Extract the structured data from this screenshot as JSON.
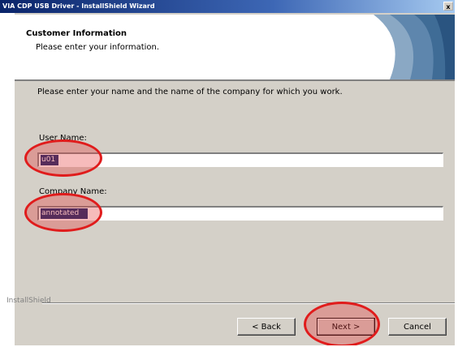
{
  "window": {
    "title": "VIA CDP USB Driver - InstallShield Wizard",
    "close_glyph": "x"
  },
  "header": {
    "title": "Customer Information",
    "subtitle": "Please enter your information."
  },
  "instruction": "Please enter your name and the name of the company for which you work.",
  "user_name": {
    "label": "User Name:",
    "value": "u01"
  },
  "company_name": {
    "label": "Company Name:",
    "value": "annotated"
  },
  "footer": {
    "brand": "InstallShield"
  },
  "buttons": {
    "back": "< Back",
    "next": "Next >",
    "cancel": "Cancel"
  },
  "annotation_color": "#e01c1c",
  "colors": {
    "title_bar": "#0a246a",
    "dialog_bg": "#d4d0c8",
    "selection": "#0a246a"
  }
}
